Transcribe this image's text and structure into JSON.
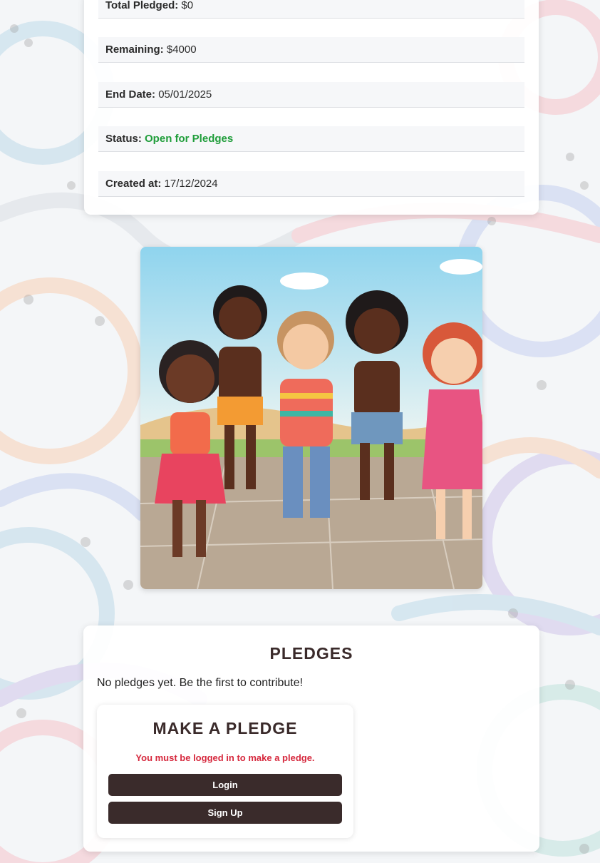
{
  "campaign": {
    "rows": [
      {
        "label": "Total Pledged:",
        "value": "$0"
      },
      {
        "label": "Remaining:",
        "value": "$4000"
      },
      {
        "label": "End Date:",
        "value": "05/01/2025"
      },
      {
        "label": "Status:",
        "value": "Open for Pledges"
      },
      {
        "label": "Created at:",
        "value": "17/12/2024"
      }
    ],
    "status_color": "#1f9d3a"
  },
  "hero_image": {
    "icon": "children-dancing-illustration"
  },
  "pledges": {
    "title": "PLEDGES",
    "empty_text": "No pledges yet. Be the first to contribute!",
    "form": {
      "title": "MAKE A PLEDGE",
      "login_message": "You must be logged in to make a pledge.",
      "login_label": "Login",
      "signup_label": "Sign Up"
    }
  },
  "theme": {
    "button_color": "#3a2b2b",
    "error_color": "#d6283d"
  }
}
